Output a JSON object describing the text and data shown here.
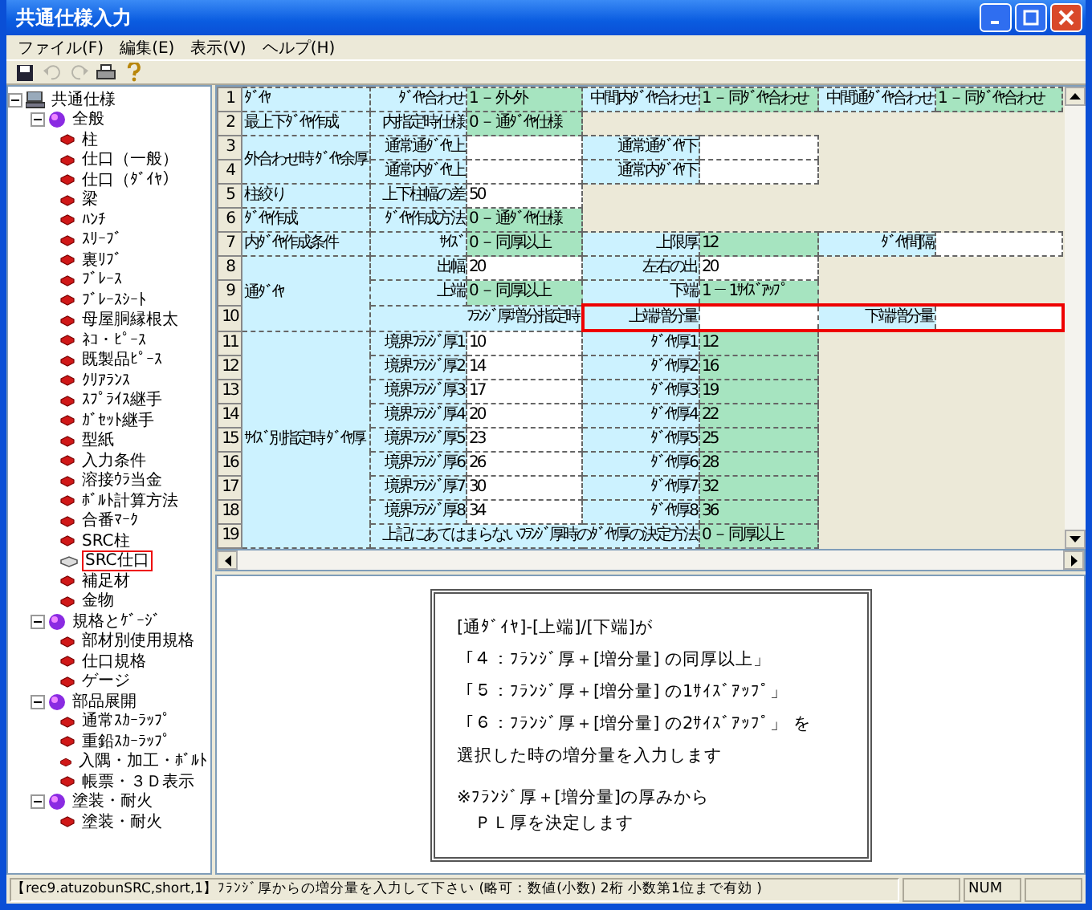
{
  "window": {
    "title": "共通仕様入力"
  },
  "menu": [
    "ファイル(F)",
    "編集(E)",
    "表示(V)",
    "ヘルプ(H)"
  ],
  "toolbar": [
    {
      "kind": "save",
      "disabled": false
    },
    {
      "kind": "undo",
      "disabled": true
    },
    {
      "kind": "redo",
      "disabled": true
    },
    {
      "kind": "print",
      "disabled": false
    },
    {
      "kind": "help",
      "disabled": false
    }
  ],
  "tree": [
    {
      "label": "共通仕様",
      "kind": "root",
      "selected": false,
      "expanded": true,
      "children": [
        {
          "label": "全般",
          "kind": "group",
          "selected": false,
          "expanded": true,
          "children": [
            {
              "label": "柱",
              "kind": "item",
              "selected": false
            },
            {
              "label": "仕口（一般）",
              "kind": "item",
              "selected": false
            },
            {
              "label": "仕口（ﾀﾞｲﾔ）",
              "kind": "item",
              "selected": false
            },
            {
              "label": "梁",
              "kind": "item",
              "selected": false
            },
            {
              "label": "ﾊﾝﾁ",
              "kind": "item",
              "selected": false
            },
            {
              "label": "ｽﾘｰﾌﾞ",
              "kind": "item",
              "selected": false
            },
            {
              "label": "裏ﾘﾌﾞ",
              "kind": "item",
              "selected": false
            },
            {
              "label": "ﾌﾞﾚｰｽ",
              "kind": "item",
              "selected": false
            },
            {
              "label": "ﾌﾞﾚｰｽｼｰﾄ",
              "kind": "item",
              "selected": false
            },
            {
              "label": "母屋胴縁根太",
              "kind": "item",
              "selected": false
            },
            {
              "label": "ﾈｺ・ﾋﾟｰｽ",
              "kind": "item",
              "selected": false
            },
            {
              "label": "既製品ﾋﾟｰｽ",
              "kind": "item",
              "selected": false
            },
            {
              "label": "ｸﾘｱﾗﾝｽ",
              "kind": "item",
              "selected": false
            },
            {
              "label": "ｽﾌﾟﾗｲｽ継手",
              "kind": "item",
              "selected": false
            },
            {
              "label": "ｶﾞｾｯﾄ継手",
              "kind": "item",
              "selected": false
            },
            {
              "label": "型紙",
              "kind": "item",
              "selected": false
            },
            {
              "label": "入力条件",
              "kind": "item",
              "selected": false
            },
            {
              "label": "溶接ｳﾗ当金",
              "kind": "item",
              "selected": false
            },
            {
              "label": "ﾎﾞﾙﾄ計算方法",
              "kind": "item",
              "selected": false
            },
            {
              "label": "合番ﾏｰｸ",
              "kind": "item",
              "selected": false
            },
            {
              "label": "SRC柱",
              "kind": "item",
              "selected": false
            },
            {
              "label": "SRC仕口",
              "kind": "item",
              "selected": true
            },
            {
              "label": "補足材",
              "kind": "item",
              "selected": false
            },
            {
              "label": "金物",
              "kind": "item",
              "selected": false
            }
          ]
        },
        {
          "label": "規格とｹﾞｰｼﾞ",
          "kind": "group",
          "selected": false,
          "expanded": true,
          "children": [
            {
              "label": "部材別使用規格",
              "kind": "item",
              "selected": false
            },
            {
              "label": "仕口規格",
              "kind": "item",
              "selected": false
            },
            {
              "label": "ゲージ",
              "kind": "item",
              "selected": false
            }
          ]
        },
        {
          "label": "部品展開",
          "kind": "group",
          "selected": false,
          "expanded": true,
          "children": [
            {
              "label": "通常ｽｶｰﾗｯﾌﾟ",
              "kind": "item",
              "selected": false
            },
            {
              "label": "重鉛ｽｶｰﾗｯﾌﾟ",
              "kind": "item",
              "selected": false
            },
            {
              "label": "入隅・加工・ﾎﾞﾙﾄ",
              "kind": "item",
              "selected": false
            },
            {
              "label": "帳票・３Ｄ表示",
              "kind": "item",
              "selected": false
            }
          ]
        },
        {
          "label": "塗装・耐火",
          "kind": "group",
          "selected": false,
          "expanded": true,
          "children": [
            {
              "label": "塗装・耐火",
              "kind": "item",
              "selected": false
            }
          ]
        }
      ]
    }
  ],
  "grid": [
    {
      "label": "ﾀﾞｲﾔ",
      "rows": [
        {
          "num": "1",
          "selected": false,
          "cells": [
            {
              "kind": "label",
              "text": "ﾀﾞｲﾔ合わせ"
            },
            {
              "kind": "choice",
              "text": "1 － 外-外"
            },
            {
              "kind": "label",
              "text": "中間内ﾀﾞｲﾔ合わせ"
            },
            {
              "kind": "choice",
              "text": "1 － 同ﾀﾞｲﾔ合わせ"
            },
            {
              "kind": "label",
              "text": "中間通ﾀﾞｲﾔ合わせ"
            },
            {
              "kind": "choice",
              "text": "1 － 同ﾀﾞｲﾔ合わせ"
            }
          ]
        }
      ]
    },
    {
      "label": "最上下ﾀﾞｲﾔ作成",
      "rows": [
        {
          "num": "2",
          "selected": false,
          "cells": [
            {
              "kind": "label",
              "text": "内指定時仕様"
            },
            {
              "kind": "choice",
              "text": "0 － 通ﾀﾞｲﾔ仕様"
            }
          ]
        }
      ]
    },
    {
      "label": "外合わせ時 ﾀﾞｲﾔ余厚",
      "rows": [
        {
          "num": "3",
          "selected": false,
          "cells": [
            {
              "kind": "label",
              "text": "通常通ﾀﾞｲﾔ上"
            },
            {
              "kind": "value"
            },
            {
              "kind": "label",
              "text": "通常通ﾀﾞｲﾔ下"
            },
            {
              "kind": "value"
            }
          ]
        },
        {
          "num": "4",
          "selected": false,
          "cells": [
            {
              "kind": "label",
              "text": "通常内ﾀﾞｲﾔ上"
            },
            {
              "kind": "value"
            },
            {
              "kind": "label",
              "text": "通常内ﾀﾞｲﾔ下"
            },
            {
              "kind": "value"
            }
          ]
        }
      ]
    },
    {
      "label": "柱絞り",
      "rows": [
        {
          "num": "5",
          "selected": false,
          "cells": [
            {
              "kind": "label",
              "text": "上下柱幅の差"
            },
            {
              "kind": "value",
              "text": "50"
            }
          ]
        }
      ]
    },
    {
      "label": "ﾀﾞｲﾔ作成",
      "rows": [
        {
          "num": "6",
          "selected": false,
          "cells": [
            {
              "kind": "label",
              "text": "ﾀﾞｲﾔ作成方法"
            },
            {
              "kind": "choice",
              "text": "0 － 通ﾀﾞｲﾔ仕様"
            }
          ]
        }
      ]
    },
    {
      "label": "内ﾀﾞｲﾔ作成条件",
      "rows": [
        {
          "num": "7",
          "selected": false,
          "cells": [
            {
              "kind": "label",
              "text": "ｻｲｽﾞ"
            },
            {
              "kind": "choice",
              "text": "0 － 同厚以上"
            },
            {
              "kind": "label",
              "text": "上限厚"
            },
            {
              "kind": "choice",
              "text": "12"
            },
            {
              "kind": "label",
              "text": "ﾀﾞｲﾔ間隔"
            },
            {
              "kind": "value"
            }
          ]
        }
      ]
    },
    {
      "label": "通ﾀﾞｲﾔ",
      "rows": [
        {
          "num": "8",
          "selected": false,
          "cells": [
            {
              "kind": "label",
              "text": "出幅"
            },
            {
              "kind": "value",
              "text": "20"
            },
            {
              "kind": "label",
              "text": "左右の出"
            },
            {
              "kind": "value",
              "text": "20"
            }
          ]
        },
        {
          "num": "9",
          "selected": false,
          "cells": [
            {
              "kind": "label",
              "text": "上端"
            },
            {
              "kind": "choice",
              "text": "0 － 同厚以上"
            },
            {
              "kind": "label",
              "text": "下端"
            },
            {
              "kind": "choice",
              "text": "1 － 1ｻｲｽﾞｱｯﾌﾟ"
            }
          ]
        },
        {
          "num": "10",
          "selected": true,
          "cells": [
            {
              "kind": "label",
              "colspan": 2,
              "text": "ﾌﾗﾝｼﾞ厚増分指定時"
            },
            {
              "kind": "label",
              "text": "上端増分量"
            },
            {
              "kind": "value"
            },
            {
              "kind": "label",
              "text": "下端増分量"
            },
            {
              "kind": "value"
            }
          ]
        }
      ]
    },
    {
      "label": "ｻｲｽﾞ別指定時 ﾀﾞｲﾔ厚",
      "rows": [
        {
          "num": "11",
          "selected": false,
          "cells": [
            {
              "kind": "label",
              "text": "境界ﾌﾗﾝｼﾞ厚1"
            },
            {
              "kind": "value",
              "text": "10"
            },
            {
              "kind": "label",
              "text": "ﾀﾞｲﾔ厚1"
            },
            {
              "kind": "choice",
              "text": "12"
            }
          ]
        },
        {
          "num": "12",
          "selected": false,
          "cells": [
            {
              "kind": "label",
              "text": "境界ﾌﾗﾝｼﾞ厚2"
            },
            {
              "kind": "value",
              "text": "14"
            },
            {
              "kind": "label",
              "text": "ﾀﾞｲﾔ厚2"
            },
            {
              "kind": "choice",
              "text": "16"
            }
          ]
        },
        {
          "num": "13",
          "selected": false,
          "cells": [
            {
              "kind": "label",
              "text": "境界ﾌﾗﾝｼﾞ厚3"
            },
            {
              "kind": "value",
              "text": "17"
            },
            {
              "kind": "label",
              "text": "ﾀﾞｲﾔ厚3"
            },
            {
              "kind": "choice",
              "text": "19"
            }
          ]
        },
        {
          "num": "14",
          "selected": false,
          "cells": [
            {
              "kind": "label",
              "text": "境界ﾌﾗﾝｼﾞ厚4"
            },
            {
              "kind": "value",
              "text": "20"
            },
            {
              "kind": "label",
              "text": "ﾀﾞｲﾔ厚4"
            },
            {
              "kind": "choice",
              "text": "22"
            }
          ]
        },
        {
          "num": "15",
          "selected": false,
          "cells": [
            {
              "kind": "label",
              "text": "境界ﾌﾗﾝｼﾞ厚5"
            },
            {
              "kind": "value",
              "text": "23"
            },
            {
              "kind": "label",
              "text": "ﾀﾞｲﾔ厚5"
            },
            {
              "kind": "choice",
              "text": "25"
            }
          ]
        },
        {
          "num": "16",
          "selected": false,
          "cells": [
            {
              "kind": "label",
              "text": "境界ﾌﾗﾝｼﾞ厚6"
            },
            {
              "kind": "value",
              "text": "26"
            },
            {
              "kind": "label",
              "text": "ﾀﾞｲﾔ厚6"
            },
            {
              "kind": "choice",
              "text": "28"
            }
          ]
        },
        {
          "num": "17",
          "selected": false,
          "cells": [
            {
              "kind": "label",
              "text": "境界ﾌﾗﾝｼﾞ厚7"
            },
            {
              "kind": "value",
              "text": "30"
            },
            {
              "kind": "label",
              "text": "ﾀﾞｲﾔ厚7"
            },
            {
              "kind": "choice",
              "text": "32"
            }
          ]
        },
        {
          "num": "18",
          "selected": false,
          "cells": [
            {
              "kind": "label",
              "text": "境界ﾌﾗﾝｼﾞ厚8"
            },
            {
              "kind": "value",
              "text": "34"
            },
            {
              "kind": "label",
              "text": "ﾀﾞｲﾔ厚8"
            },
            {
              "kind": "choice",
              "text": "36"
            }
          ]
        },
        {
          "num": "19",
          "selected": false,
          "cells": [
            {
              "kind": "label",
              "colspan": 3,
              "text": "上記にあてはまらないﾌﾗﾝｼﾞ厚時のﾀﾞｲﾔ厚の決定方法"
            },
            {
              "kind": "choice",
              "text": "0 － 同厚以上"
            }
          ]
        }
      ]
    }
  ],
  "help": {
    "lines": [
      "[通ﾀﾞｲﾔ]-[上端]/[下端]が",
      "「４：ﾌﾗﾝｼﾞ厚＋[増分量] の同厚以上」",
      "「５：ﾌﾗﾝｼﾞ厚＋[増分量] の1ｻｲｽﾞｱｯﾌﾟ」",
      "「６：ﾌﾗﾝｼﾞ厚＋[増分量] の2ｻｲｽﾞｱｯﾌﾟ」 を",
      "選択した時の増分量を入力します"
    ],
    "note": [
      "※ﾌﾗﾝｼﾞ厚＋[増分量]の厚みから",
      "　ＰＬ厚を決定します"
    ]
  },
  "status_bar": {
    "message": "【rec9.atuzobunSRC,short,1】ﾌﾗﾝｼﾞ厚からの増分量を入力して下さい (略可：数値(小数) 2桁 小数第1位まで有効 )",
    "panes": [
      "NUM"
    ]
  }
}
